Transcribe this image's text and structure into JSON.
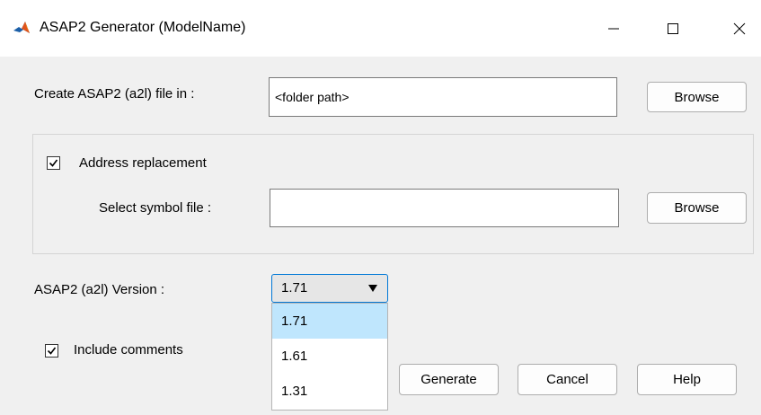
{
  "window": {
    "title": "ASAP2 Generator (ModelName)",
    "icon": "matlab-icon"
  },
  "output": {
    "label": "Create ASAP2 (a2l) file in :",
    "value": "<folder path>",
    "browse_label": "Browse"
  },
  "address": {
    "checkbox_label": "Address replacement",
    "checked": true,
    "symbol_label": "Select symbol file :",
    "symbol_value": "",
    "browse_label": "Browse"
  },
  "version": {
    "label": "ASAP2 (a2l)  Version :",
    "selected": "1.71",
    "options": [
      "1.71",
      "1.61",
      "1.31"
    ]
  },
  "comments": {
    "label": "Include comments",
    "checked": true
  },
  "buttons": {
    "generate": "Generate",
    "cancel": "Cancel",
    "help": "Help"
  }
}
